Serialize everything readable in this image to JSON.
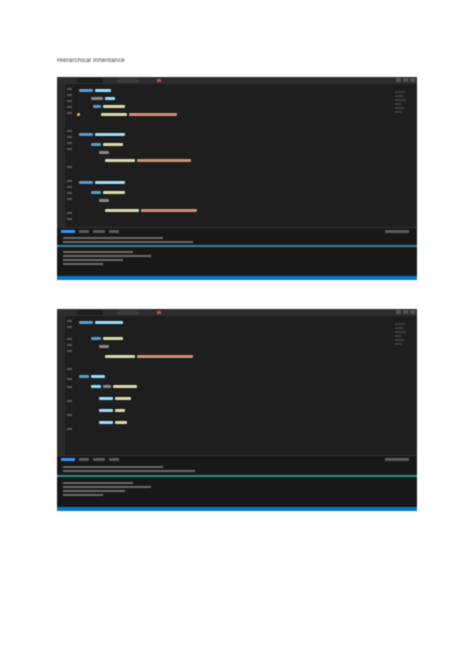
{
  "document": {
    "heading": "Hierarchical Inheritance"
  },
  "colors": {
    "page_background": "#ffffff",
    "editor_background": "#1e1e1e",
    "keyword": "#569cd6",
    "function": "#dcdcaa",
    "string": "#ce9178",
    "variable": "#9cdcfe",
    "comment": "#6a9955",
    "status_bar": "#007acc",
    "terminal_accent": "#2aa3a3"
  },
  "screenshots": [
    {
      "kind": "code-editor",
      "theme": "dark",
      "has_terminal_panel": true
    },
    {
      "kind": "code-editor",
      "theme": "dark",
      "has_terminal_panel": true
    }
  ]
}
